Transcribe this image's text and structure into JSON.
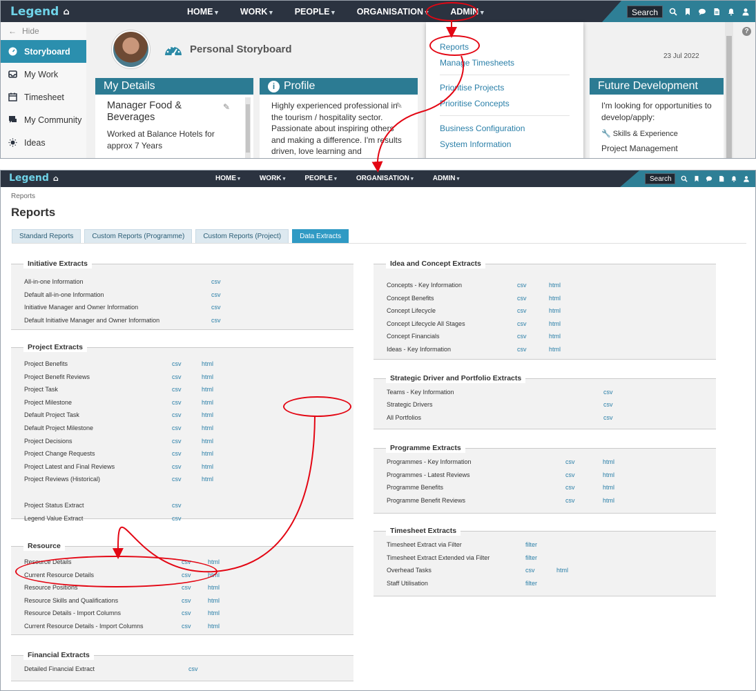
{
  "top": {
    "logo": "Legend",
    "menu": [
      "HOME",
      "WORK",
      "PEOPLE",
      "ORGANISATION",
      "ADMIN"
    ],
    "search_label": "Search",
    "sidebar": {
      "hide": "Hide",
      "items": [
        "Storyboard",
        "My Work",
        "Timesheet",
        "My Community",
        "Ideas"
      ]
    },
    "page_title": "Personal Storyboard",
    "date": "23 Jul 2022",
    "cards": {
      "details": {
        "title": "My Details",
        "role": "Manager Food & Beverages",
        "text": "Worked at Balance Hotels for approx 7 Years"
      },
      "profile": {
        "title": "Profile",
        "text": "Highly experienced professional in the tourism / hospitality sector. Passionate about inspiring others and making a difference. I'm results driven, love learning and relentlessly"
      },
      "future": {
        "title": "Future Development",
        "text": "I'm looking for opportunities to develop/apply:",
        "skills_label": "Skills & Experience",
        "skill": "Project Management"
      }
    },
    "admin_dropdown": {
      "group1": [
        "Reports",
        "Manage Timesheets"
      ],
      "group2": [
        "Prioritise Projects",
        "Prioritise Concepts"
      ],
      "group3": [
        "Business Configuration",
        "System Information"
      ]
    }
  },
  "bottom": {
    "logo": "Legend",
    "menu": [
      "HOME",
      "WORK",
      "PEOPLE",
      "ORGANISATION",
      "ADMIN"
    ],
    "search_label": "Search",
    "breadcrumb": "Reports",
    "title": "Reports",
    "tabs": [
      "Standard Reports",
      "Custom Reports (Programme)",
      "Custom Reports (Project)",
      "Data Extracts"
    ],
    "left_panels": [
      {
        "title": "Initiative Extracts",
        "rows": [
          {
            "name": "All-in-one Information",
            "links": [
              "csv"
            ]
          },
          {
            "name": "Default all-in-one Information",
            "links": [
              "csv"
            ]
          },
          {
            "name": "Initiative Manager and Owner Information",
            "links": [
              "csv"
            ]
          },
          {
            "name": "Default Initiative Manager and Owner Information",
            "links": [
              "csv"
            ]
          }
        ]
      },
      {
        "title": "Project Extracts",
        "rows": [
          {
            "name": "Project Benefits",
            "links": [
              "csv",
              "html"
            ]
          },
          {
            "name": "Project Benefit Reviews",
            "links": [
              "csv",
              "html"
            ]
          },
          {
            "name": "Project Task",
            "links": [
              "csv",
              "html"
            ]
          },
          {
            "name": "Project Milestone",
            "links": [
              "csv",
              "html"
            ]
          },
          {
            "name": "Default Project Task",
            "links": [
              "csv",
              "html"
            ]
          },
          {
            "name": "Default Project Milestone",
            "links": [
              "csv",
              "html"
            ]
          },
          {
            "name": "Project Decisions",
            "links": [
              "csv",
              "html"
            ]
          },
          {
            "name": "Project Change Requests",
            "links": [
              "csv",
              "html"
            ]
          },
          {
            "name": "Project Latest and Final Reviews",
            "links": [
              "csv",
              "html"
            ]
          },
          {
            "name": "Project Reviews (Historical)",
            "links": [
              "csv",
              "html"
            ]
          },
          {
            "name": "Project Status Extract",
            "links": [
              "csv"
            ]
          },
          {
            "name": "Legend Value Extract",
            "links": [
              "csv"
            ]
          }
        ]
      },
      {
        "title": "Resource",
        "rows": [
          {
            "name": "Resource Details",
            "links": [
              "csv",
              "html"
            ]
          },
          {
            "name": "Current Resource Details",
            "links": [
              "csv",
              "html"
            ]
          },
          {
            "name": "Resource Positions",
            "links": [
              "csv",
              "html"
            ]
          },
          {
            "name": "Resource Skills and Qualifications",
            "links": [
              "csv",
              "html"
            ]
          },
          {
            "name": "Resource Details - Import Columns",
            "links": [
              "csv",
              "html"
            ]
          },
          {
            "name": "Current Resource Details - Import Columns",
            "links": [
              "csv",
              "html"
            ]
          }
        ]
      },
      {
        "title": "Financial Extracts",
        "rows": [
          {
            "name": "Detailed Financial Extract",
            "links": [
              "csv"
            ]
          }
        ]
      }
    ],
    "right_panels": [
      {
        "title": "Idea and Concept Extracts",
        "rows": [
          {
            "name": "Concepts - Key Information",
            "links": [
              "csv",
              "html"
            ]
          },
          {
            "name": "Concept Benefits",
            "links": [
              "csv",
              "html"
            ]
          },
          {
            "name": "Concept Lifecycle",
            "links": [
              "csv",
              "html"
            ]
          },
          {
            "name": "Concept Lifecycle All Stages",
            "links": [
              "csv",
              "html"
            ]
          },
          {
            "name": "Concept Financials",
            "links": [
              "csv",
              "html"
            ]
          },
          {
            "name": "Ideas - Key Information",
            "links": [
              "csv",
              "html"
            ]
          }
        ]
      },
      {
        "title": "Strategic Driver and Portfolio Extracts",
        "rows": [
          {
            "name": "Teams - Key Information",
            "links": [
              "csv"
            ]
          },
          {
            "name": "Strategic Drivers",
            "links": [
              "csv"
            ]
          },
          {
            "name": "All Portfolios",
            "links": [
              "csv"
            ]
          }
        ]
      },
      {
        "title": "Programme Extracts",
        "rows": [
          {
            "name": "Programmes - Key Information",
            "links": [
              "csv",
              "html"
            ]
          },
          {
            "name": "Programmes - Latest Reviews",
            "links": [
              "csv",
              "html"
            ]
          },
          {
            "name": "Programme Benefits",
            "links": [
              "csv",
              "html"
            ]
          },
          {
            "name": "Programme Benefit Reviews",
            "links": [
              "csv",
              "html"
            ]
          }
        ]
      },
      {
        "title": "Timesheet Extracts",
        "rows": [
          {
            "name": "Timesheet Extract via Filter",
            "links": [
              "filter"
            ]
          },
          {
            "name": "Timesheet Extract Extended via Filter",
            "links": [
              "filter"
            ]
          },
          {
            "name": "Overhead Tasks",
            "links": [
              "csv",
              "html"
            ]
          },
          {
            "name": "Staff Utilisation",
            "links": [
              "filter"
            ]
          }
        ]
      }
    ]
  },
  "colors": {
    "nav_bg": "#2b3340",
    "nav_accent": "#2e7f96",
    "link": "#2a7fa8",
    "active_tab": "#2f9ac4",
    "card_header": "#2c7b93",
    "annotation": "#e30613"
  }
}
